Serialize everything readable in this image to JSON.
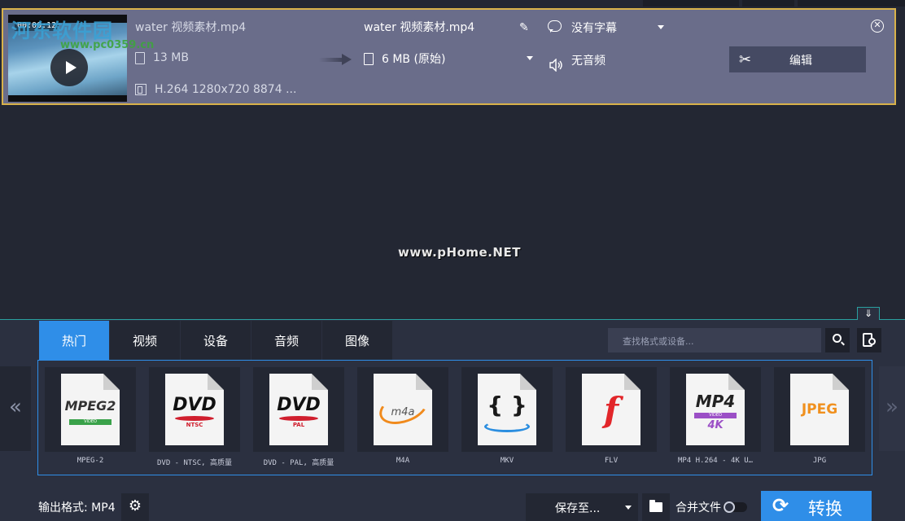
{
  "file": {
    "thumb_time": "00:00:12",
    "source_name": "water 视频素材.mp4",
    "source_size": "13 MB",
    "source_codec": "H.264 1280x720 8874 ...",
    "output_name": "water 视频素材.mp4",
    "output_size": "6 MB (原始)",
    "subtitle": "没有字幕",
    "audio": "无音频",
    "edit_label": "编辑"
  },
  "watermarks": {
    "site_cn": "河东软件园",
    "site_url": "www.pc0359.cn",
    "center": "www.pHome.NET"
  },
  "tabs": [
    {
      "label": "热门",
      "active": true
    },
    {
      "label": "视频",
      "active": false
    },
    {
      "label": "设备",
      "active": false
    },
    {
      "label": "音频",
      "active": false
    },
    {
      "label": "图像",
      "active": false
    }
  ],
  "search": {
    "placeholder": "查找格式或设备..."
  },
  "presets": [
    {
      "caption": "MPEG-2",
      "logo": "MPEG2"
    },
    {
      "caption": "DVD - NTSC, 高质量",
      "logo": "DVD"
    },
    {
      "caption": "DVD - PAL, 高质量",
      "logo": "DVD"
    },
    {
      "caption": "M4A",
      "logo": "m4a"
    },
    {
      "caption": "MKV",
      "logo": "{ }"
    },
    {
      "caption": "FLV",
      "logo": "f"
    },
    {
      "caption": "MP4 H.264 - 4K U…",
      "logo": "MP4"
    },
    {
      "caption": "JPG",
      "logo": "JPEG"
    }
  ],
  "preset_sublogos": {
    "mpeg2": "VIDEO",
    "ntsc": "NTSC",
    "pal": "PAL",
    "mp4_video": "VIDEO",
    "mp4_4k": "4K"
  },
  "bottom": {
    "output_format": "输出格式: MP4",
    "save_to": "保存至...",
    "merge": "合并文件",
    "convert": "转换"
  },
  "nav": {
    "prev": "«",
    "next": "»"
  },
  "colors": {
    "accent": "#2f8ee8",
    "selection_border": "#d8b24a",
    "row_bg": "#6a6d8a"
  }
}
